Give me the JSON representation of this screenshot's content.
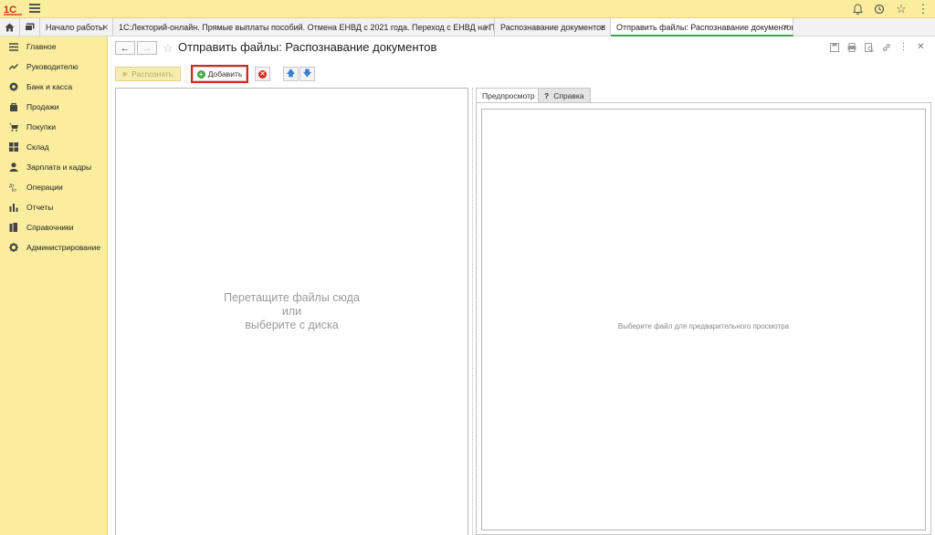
{
  "app": {
    "logo_text": "1С"
  },
  "top_icons": [
    "bell-icon",
    "history-icon",
    "star-icon",
    "more-icon"
  ],
  "tabs": [
    {
      "label": "Начало работы"
    },
    {
      "label": "1С:Лекторий-онлайн. Прямые выплаты пособий. Отмена ЕНВД с 2021 года. Переход с ЕНВД на Патент."
    },
    {
      "label": "Распознавание документов"
    },
    {
      "label": "Отправить файлы: Распознавание документов",
      "active": true
    }
  ],
  "sidebar": {
    "items": [
      {
        "label": "Главное",
        "icon": "menu-lines-icon"
      },
      {
        "label": "Руководителю",
        "icon": "trend-icon"
      },
      {
        "label": "Банк и касса",
        "icon": "coins-icon"
      },
      {
        "label": "Продажи",
        "icon": "bag-icon"
      },
      {
        "label": "Покупки",
        "icon": "cart-icon"
      },
      {
        "label": "Склад",
        "icon": "warehouse-icon"
      },
      {
        "label": "Зарплата и кадры",
        "icon": "person-icon"
      },
      {
        "label": "Операции",
        "icon": "operations-icon"
      },
      {
        "label": "Отчеты",
        "icon": "bar-chart-icon"
      },
      {
        "label": "Справочники",
        "icon": "books-icon"
      },
      {
        "label": "Администрирование",
        "icon": "gear-icon"
      }
    ]
  },
  "page": {
    "title": "Отправить файлы: Распознавание документов"
  },
  "toolbar": {
    "recognize_label": "Распознать",
    "add_label": "Добавить"
  },
  "dropzone": {
    "line1": "Перетащите файлы сюда",
    "line2": "или",
    "line3": "выберите с диска"
  },
  "preview_tabs": {
    "preview_label": "Предпросмотр",
    "help_label": "Справка"
  },
  "preview": {
    "placeholder": "Выберите файл для предварительного просмотра"
  },
  "colors": {
    "sidebar_bg": "#fbed9e",
    "highlight": "#d9261c",
    "active_tab": "#3fa34d"
  }
}
